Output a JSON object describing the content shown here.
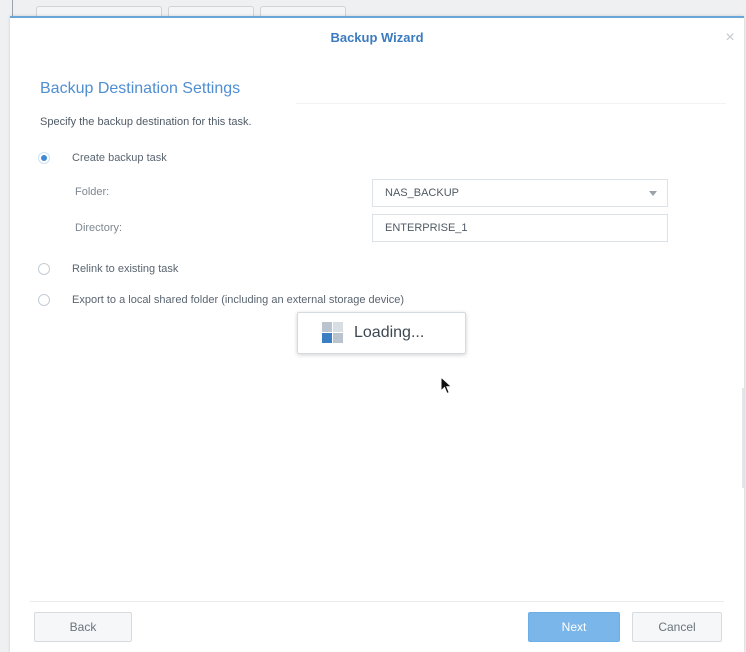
{
  "dialog": {
    "title": "Backup Wizard",
    "close_symbol": "×"
  },
  "section": {
    "title": "Backup Destination Settings",
    "description": "Specify the backup destination for this task."
  },
  "options": {
    "create": {
      "label": "Create backup task",
      "checked": true
    },
    "relink": {
      "label": "Relink to existing task",
      "checked": false
    },
    "export": {
      "label": "Export to a local shared folder (including an external storage device)",
      "checked": false
    }
  },
  "fields": {
    "folder": {
      "label": "Folder:",
      "value": "NAS_BACKUP"
    },
    "directory": {
      "label": "Directory:",
      "value": "ENTERPRISE_1"
    }
  },
  "loading": {
    "text": "Loading...",
    "icon": "loading-icon"
  },
  "footer": {
    "back_label": "Back",
    "next_label": "Next",
    "cancel_label": "Cancel"
  },
  "colors": {
    "accent": "#3f8ad2",
    "title_blue": "#3b7bc0",
    "next_button": "#7bb6ea"
  }
}
